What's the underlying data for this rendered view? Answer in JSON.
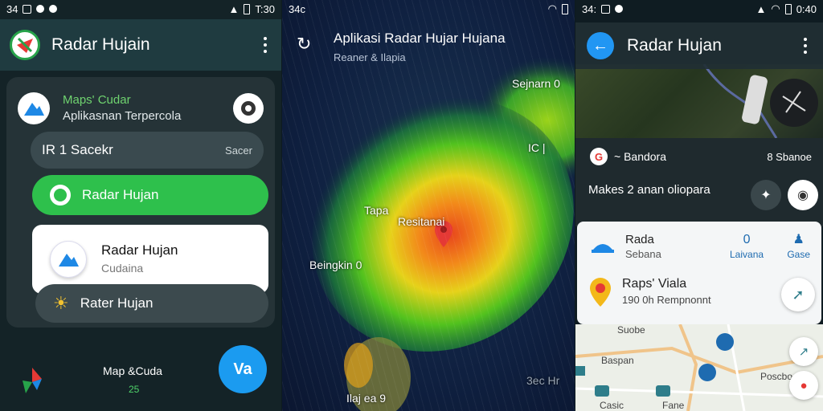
{
  "panel1": {
    "status": {
      "time_left": "34",
      "time_right": "T:30"
    },
    "app_title": "Radar Hujain",
    "header": {
      "line1": "Maps' Cudar",
      "line2": "Aplikasnan  Terpercola"
    },
    "search": {
      "label": "IR 1 Sacekr",
      "hint": "Sacer"
    },
    "green_button": "Radar Hujan",
    "white_card": {
      "title": "Radar Hujan",
      "subtitle": "Cudaina"
    },
    "dark_button": "Rater Hujan",
    "bottom": {
      "label": "Map &Cuda",
      "sub": "25"
    },
    "fab_label": "Va"
  },
  "panel2": {
    "status": {
      "time_left": "34c"
    },
    "header": {
      "title": "Aplikasi Radar Hujar Hujana",
      "subtitle": "Reaner & Ilapia"
    },
    "labels": {
      "top_right": "Sejnarn 0",
      "mid_right": "IC |",
      "tapa": "Tapa",
      "center": "Resitanai",
      "left": "Beingkin 0",
      "bottom_left": "Ilaj ea 9",
      "bottom_right": "3ec Hr"
    }
  },
  "panel3": {
    "status": {
      "time_left": "34:",
      "time_right": "0:40"
    },
    "app_title": "Radar Hujan",
    "info": {
      "row1_left": "~ Bandora",
      "row1_right": "8 Sbanoe",
      "row2": "Makes 2 anan oliopara"
    },
    "sheet": {
      "item1_title": "Rada",
      "item1_sub": "Sebana",
      "mid_value": "0",
      "mid_label": "Laivana",
      "right_label": "Gase",
      "item2_title": "Raps' Viala",
      "item2_sub": "190 0h Rempnonnt"
    },
    "street": {
      "l1": "Suobe",
      "l2": "Baspan",
      "l3": "Poscbo",
      "l4": "Casic",
      "l5": "Fane"
    }
  },
  "colors": {
    "green": "#2ec04c",
    "blue": "#1b9bf0",
    "pin": "#e53935"
  }
}
